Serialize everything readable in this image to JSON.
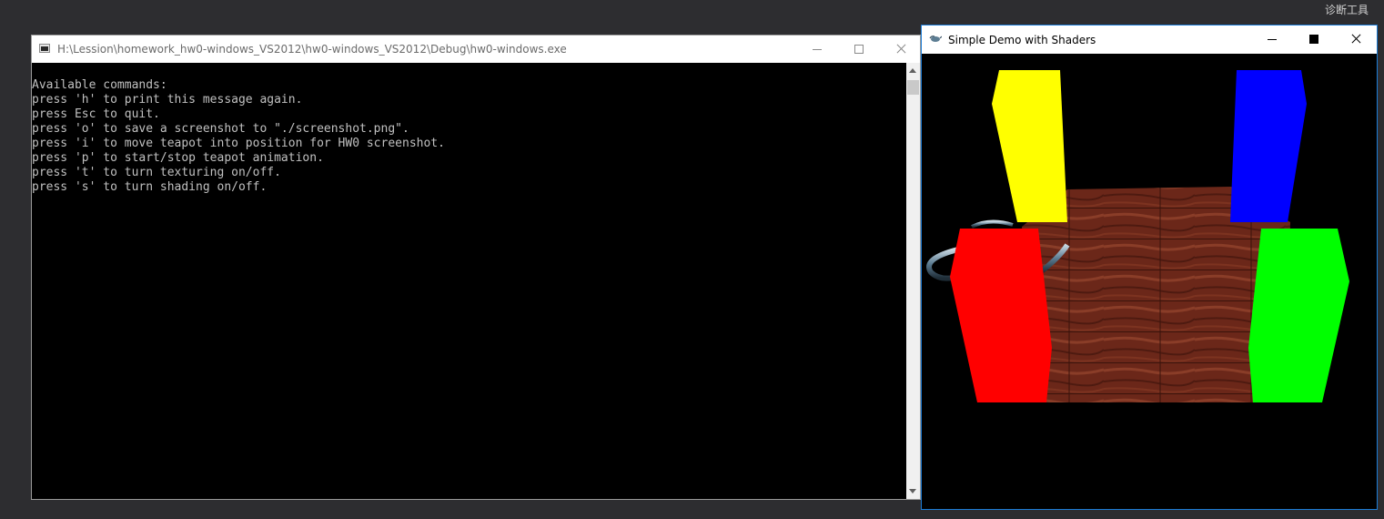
{
  "ide_strip": {
    "diagnostic_tools_label": "诊断工具"
  },
  "console": {
    "title": "H:\\Lession\\homework_hw0-windows_VS2012\\hw0-windows_VS2012\\Debug\\hw0-windows.exe",
    "lines": [
      "Available commands:",
      "press 'h' to print this message again.",
      "press Esc to quit.",
      "press 'o' to save a screenshot to \"./screenshot.png\".",
      "press 'i' to move teapot into position for HW0 screenshot.",
      "press 'p' to start/stop teapot animation.",
      "press 't' to turn texturing on/off.",
      "press 's' to turn shading on/off."
    ]
  },
  "gl_window": {
    "title": "Simple Demo with Shaders",
    "colors": {
      "background": "#000000",
      "pillar_yellow": "#ffff00",
      "pillar_blue": "#0000ff",
      "pillar_red": "#ff0000",
      "pillar_green": "#00ff00",
      "floor_wood": "#6b2a1a",
      "teapot": "#5a7a90"
    }
  },
  "icons": {
    "console_icon": "console-window-icon",
    "gl_icon": "glut-app-icon",
    "minimize": "minimize-icon",
    "maximize": "maximize-icon",
    "close": "close-icon"
  }
}
